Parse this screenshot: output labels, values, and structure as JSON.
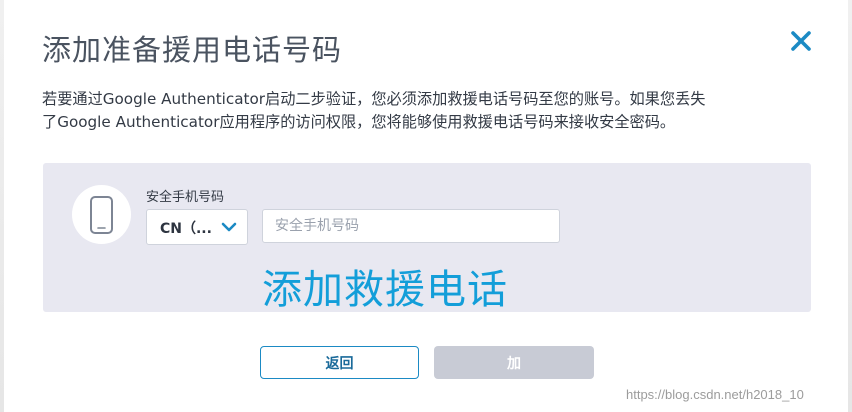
{
  "dialog": {
    "title": "添加准备援用电话号码",
    "description_line1": "若要通过Google Authenticator启动二步验证，您必须添加救援电话号码至您的账号。如果您丢失",
    "description_line2": "了Google Authenticator应用程序的访问权限，您将能够使用救援电话号码来接收安全密码。",
    "close_icon": "close-icon"
  },
  "phone_form": {
    "label": "安全手机号码",
    "country_value": "CN（...",
    "phone_placeholder": "安全手机号码",
    "phone_value": "",
    "device_icon": "smartphone-icon",
    "dropdown_icon": "chevron-down-icon"
  },
  "overlay_caption": "添加救援电话",
  "buttons": {
    "back_label": "返回",
    "add_label": "加",
    "add_enabled": false
  },
  "watermark": "https://blog.csdn.net/h2018_10",
  "colors": {
    "accent": "#1b8ac4",
    "title": "#4a5360",
    "panel": "#e8e8f1",
    "disabled_button": "#c8cbd5",
    "caption": "#139ed9"
  }
}
